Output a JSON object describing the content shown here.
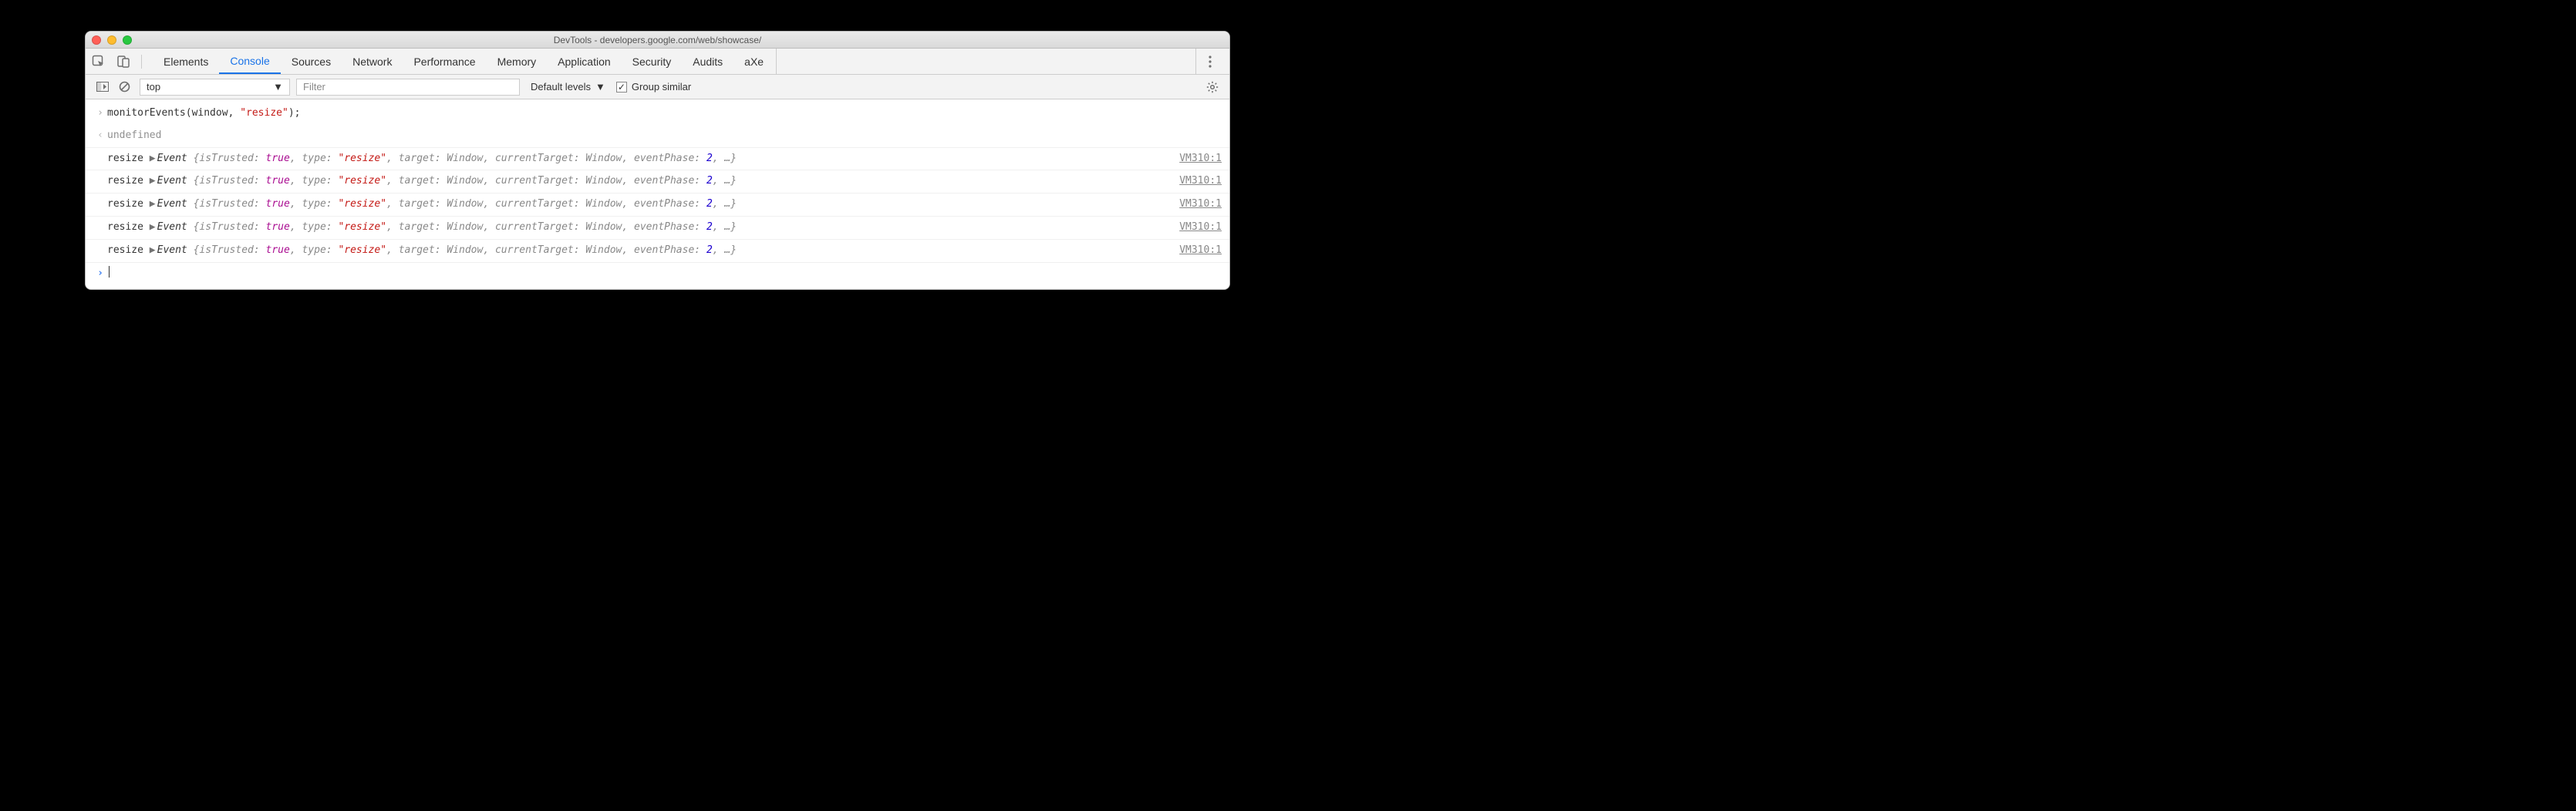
{
  "window": {
    "title": "DevTools - developers.google.com/web/showcase/"
  },
  "tabs": {
    "items": [
      "Elements",
      "Console",
      "Sources",
      "Network",
      "Performance",
      "Memory",
      "Application",
      "Security",
      "Audits",
      "aXe"
    ],
    "active_index": 1
  },
  "toolbar": {
    "context": "top",
    "filter_placeholder": "Filter",
    "levels_label": "Default levels",
    "group_similar_label": "Group similar",
    "group_similar_checked": true
  },
  "console": {
    "input_line": {
      "fn": "monitorEvents",
      "arg1": "window",
      "arg2": "\"resize\""
    },
    "return_value": "undefined",
    "events": [
      {
        "label": "resize",
        "type_name": "Event",
        "props": {
          "isTrusted": "true",
          "type": "\"resize\"",
          "target": "Window",
          "currentTarget": "Window",
          "eventPhase": "2"
        },
        "source": "VM310:1"
      },
      {
        "label": "resize",
        "type_name": "Event",
        "props": {
          "isTrusted": "true",
          "type": "\"resize\"",
          "target": "Window",
          "currentTarget": "Window",
          "eventPhase": "2"
        },
        "source": "VM310:1"
      },
      {
        "label": "resize",
        "type_name": "Event",
        "props": {
          "isTrusted": "true",
          "type": "\"resize\"",
          "target": "Window",
          "currentTarget": "Window",
          "eventPhase": "2"
        },
        "source": "VM310:1"
      },
      {
        "label": "resize",
        "type_name": "Event",
        "props": {
          "isTrusted": "true",
          "type": "\"resize\"",
          "target": "Window",
          "currentTarget": "Window",
          "eventPhase": "2"
        },
        "source": "VM310:1"
      },
      {
        "label": "resize",
        "type_name": "Event",
        "props": {
          "isTrusted": "true",
          "type": "\"resize\"",
          "target": "Window",
          "currentTarget": "Window",
          "eventPhase": "2"
        },
        "source": "VM310:1"
      }
    ]
  }
}
